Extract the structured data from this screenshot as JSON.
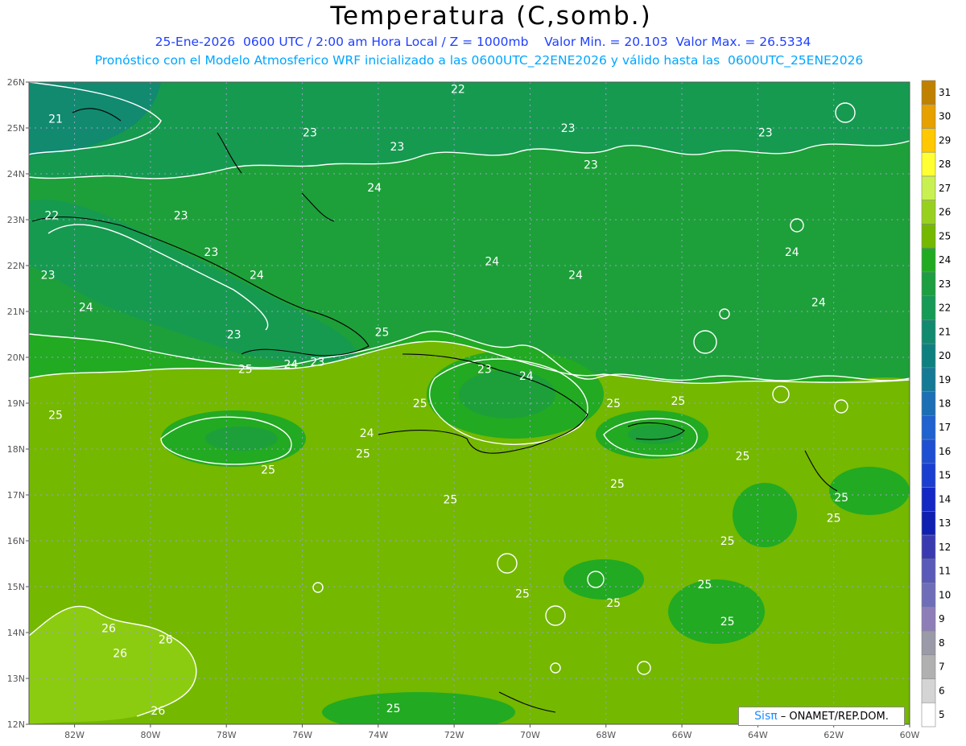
{
  "header": {
    "title": "Temperatura (C,somb.)",
    "line1": "25-Ene-2026  0600 UTC / 2:00 am Hora Local / Z = 1000mb    Valor Min. = 20.103  Valor Max. = 26.5334",
    "line2": "Pronóstico con el Modelo Atmosferico WRF inicializado a las 0600UTC_22ENE2026 y válido hasta las  0600UTC_25ENE2026"
  },
  "axes": {
    "lat_ticks": [
      "26N",
      "25N",
      "24N",
      "23N",
      "22N",
      "21N",
      "20N",
      "19N",
      "18N",
      "17N",
      "16N",
      "15N",
      "14N",
      "13N",
      "12N"
    ],
    "lon_ticks": [
      "82W",
      "80W",
      "78W",
      "76W",
      "74W",
      "72W",
      "70W",
      "68W",
      "66W",
      "64W",
      "62W",
      "60W"
    ]
  },
  "colorbar": {
    "levels": [
      "31",
      "30",
      "29",
      "28",
      "27",
      "26",
      "25",
      "24",
      "23",
      "22",
      "21",
      "20",
      "19",
      "18",
      "17",
      "16",
      "15",
      "14",
      "13",
      "12",
      "11",
      "10",
      "9",
      "8",
      "7",
      "6",
      "5"
    ],
    "colors": [
      "#c08000",
      "#e6a000",
      "#ffc800",
      "#ffff33",
      "#c8f050",
      "#98d020",
      "#74b800",
      "#22aa22",
      "#1d9e40",
      "#169a55",
      "#118a70",
      "#0e8080",
      "#157a95",
      "#1c6eb5",
      "#1f62d0",
      "#1e4ed2",
      "#1a3ed0",
      "#1428c4",
      "#1020b0",
      "#3a3ab0",
      "#5a5ab8",
      "#6e6eb8",
      "#8e7eb8",
      "#9a9aa8",
      "#b0b0b0",
      "#d4d4d4",
      "#ffffff"
    ]
  },
  "contour_labels": [
    {
      "text": "22",
      "lon": -71.9,
      "lat": 25.85
    },
    {
      "text": "21",
      "lon": -82.5,
      "lat": 25.2
    },
    {
      "text": "23",
      "lon": -75.8,
      "lat": 24.9
    },
    {
      "text": "23",
      "lon": -69.0,
      "lat": 25.0
    },
    {
      "text": "23",
      "lon": -63.8,
      "lat": 24.9
    },
    {
      "text": "23",
      "lon": -73.5,
      "lat": 24.6
    },
    {
      "text": "23",
      "lon": -68.4,
      "lat": 24.2
    },
    {
      "text": "24",
      "lon": -74.1,
      "lat": 23.7
    },
    {
      "text": "22",
      "lon": -82.6,
      "lat": 23.1
    },
    {
      "text": "23",
      "lon": -79.2,
      "lat": 23.1
    },
    {
      "text": "24",
      "lon": -63.1,
      "lat": 22.3
    },
    {
      "text": "24",
      "lon": -71.0,
      "lat": 22.1
    },
    {
      "text": "24",
      "lon": -68.8,
      "lat": 21.8
    },
    {
      "text": "23",
      "lon": -78.4,
      "lat": 22.3
    },
    {
      "text": "24",
      "lon": -77.2,
      "lat": 21.8
    },
    {
      "text": "23",
      "lon": -82.7,
      "lat": 21.8
    },
    {
      "text": "24",
      "lon": -81.7,
      "lat": 21.1
    },
    {
      "text": "24",
      "lon": -62.4,
      "lat": 21.2
    },
    {
      "text": "23",
      "lon": -77.8,
      "lat": 20.5
    },
    {
      "text": "25",
      "lon": -73.9,
      "lat": 20.55
    },
    {
      "text": "25",
      "lon": -77.5,
      "lat": 19.75
    },
    {
      "text": "24",
      "lon": -76.3,
      "lat": 19.85
    },
    {
      "text": "23",
      "lon": -75.6,
      "lat": 19.9
    },
    {
      "text": "23",
      "lon": -71.2,
      "lat": 19.75
    },
    {
      "text": "24",
      "lon": -70.1,
      "lat": 19.6
    },
    {
      "text": "25",
      "lon": -67.8,
      "lat": 19.0
    },
    {
      "text": "25",
      "lon": -66.1,
      "lat": 19.05
    },
    {
      "text": "25",
      "lon": -72.9,
      "lat": 19.0
    },
    {
      "text": "25",
      "lon": -82.5,
      "lat": 18.75
    },
    {
      "text": "24",
      "lon": -74.3,
      "lat": 18.35
    },
    {
      "text": "25",
      "lon": -74.4,
      "lat": 17.9
    },
    {
      "text": "25",
      "lon": -76.9,
      "lat": 17.55
    },
    {
      "text": "25",
      "lon": -64.4,
      "lat": 17.85
    },
    {
      "text": "25",
      "lon": -67.7,
      "lat": 17.25
    },
    {
      "text": "25",
      "lon": -72.1,
      "lat": 16.9
    },
    {
      "text": "25",
      "lon": -61.8,
      "lat": 16.95
    },
    {
      "text": "25",
      "lon": -62.0,
      "lat": 16.5
    },
    {
      "text": "25",
      "lon": -64.8,
      "lat": 16.0
    },
    {
      "text": "25",
      "lon": -65.4,
      "lat": 15.05
    },
    {
      "text": "25",
      "lon": -70.2,
      "lat": 14.85
    },
    {
      "text": "25",
      "lon": -67.8,
      "lat": 14.65
    },
    {
      "text": "25",
      "lon": -64.8,
      "lat": 14.25
    },
    {
      "text": "26",
      "lon": -81.1,
      "lat": 14.1
    },
    {
      "text": "26",
      "lon": -79.6,
      "lat": 13.85
    },
    {
      "text": "26",
      "lon": -80.8,
      "lat": 13.55
    },
    {
      "text": "26",
      "lon": -79.8,
      "lat": 12.3
    },
    {
      "text": "25",
      "lon": -73.6,
      "lat": 12.35
    }
  ],
  "credit": {
    "logo": "Sisπ",
    "text": " – ONAMET/REP.DOM."
  }
}
